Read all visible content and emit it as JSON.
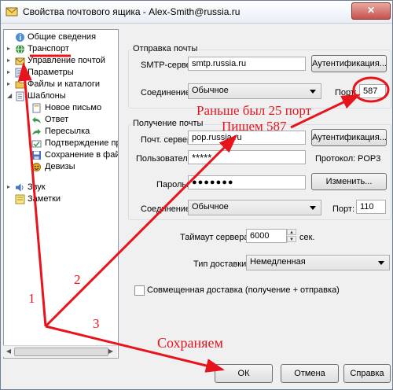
{
  "window": {
    "title": "Свойства почтового ящика - Alex-Smith@russia.ru",
    "close_icon": "close-icon"
  },
  "tree": {
    "items": [
      {
        "label": "Общие сведения",
        "icon": "info-icon"
      },
      {
        "label": "Транспорт",
        "icon": "globe-icon"
      },
      {
        "label": "Управление почтой",
        "icon": "mail-manage-icon"
      },
      {
        "label": "Параметры",
        "icon": "settings-icon"
      },
      {
        "label": "Файлы и каталоги",
        "icon": "folder-icon"
      },
      {
        "label": "Шаблоны",
        "icon": "templates-icon"
      },
      {
        "label": "Новое письмо",
        "icon": "new-letter-icon"
      },
      {
        "label": "Ответ",
        "icon": "reply-icon"
      },
      {
        "label": "Пересылка",
        "icon": "forward-icon"
      },
      {
        "label": "Подтверждение проч",
        "icon": "confirm-icon"
      },
      {
        "label": "Сохранение в файл",
        "icon": "save-file-icon"
      },
      {
        "label": "Девизы",
        "icon": "mottos-icon"
      },
      {
        "label": "Звук",
        "icon": "sound-icon"
      },
      {
        "label": "Заметки",
        "icon": "notes-icon"
      }
    ]
  },
  "outgoing": {
    "title": "Отправка почты",
    "smtp_label": "SMTP-сервер:",
    "smtp_value": "smtp.russia.ru",
    "auth_button": "Аутентификация...",
    "connection_label": "Соединение:",
    "connection_value": "Обычное",
    "port_label": "Порт:",
    "port_value": "587"
  },
  "incoming": {
    "title": "Получение почты",
    "server_label": "Почт. сервер:",
    "server_value": "pop.russia.ru",
    "auth_button": "Аутентификация...",
    "user_label": "Пользователь:",
    "user_value": "*****",
    "protocol_label": "Протокол:",
    "protocol_value": "POP3",
    "password_label": "Пароль:",
    "password_value": "●●●●●●●",
    "change_button": "Изменить...",
    "connection_label": "Соединение:",
    "connection_value": "Обычное",
    "port_label": "Порт:",
    "port_value": "110"
  },
  "timeout": {
    "label": "Таймаут сервера:",
    "value": "6000",
    "unit": "сек."
  },
  "delivery": {
    "label": "Тип доставки:",
    "value": "Немедленная"
  },
  "combined": {
    "label": "Совмещенная доставка (получение + отправка)"
  },
  "buttons": {
    "ok": "ОК",
    "cancel": "Отмена",
    "help": "Справка"
  },
  "annotations": {
    "note_port_1": "Раньше был 25 порт",
    "note_port_2": "Пишем 587",
    "note_save": "Сохраняем",
    "num_1": "1",
    "num_2": "2",
    "num_3": "3",
    "color": "#e8141c"
  }
}
